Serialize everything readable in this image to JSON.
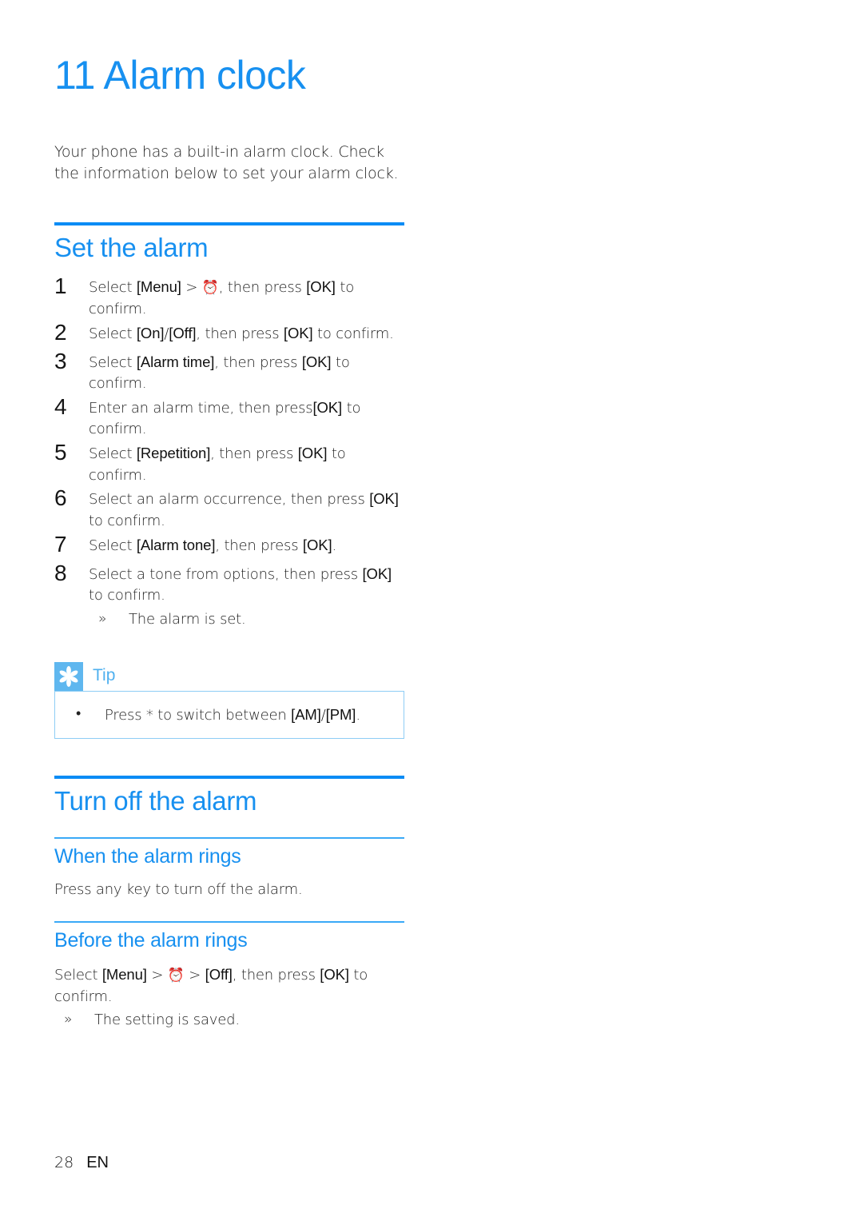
{
  "chapter": {
    "number": "11",
    "title": "11 Alarm clock",
    "intro": "Your phone has a built-in alarm clock. Check the information below to set your alarm clock."
  },
  "colors": {
    "accent_blue": "#1790f0",
    "rule_thick": "#0a8cf5",
    "rule_thin": "#3aa9f7",
    "tip_badge": "#5fb7ef",
    "tip_border": "#8ecdf5",
    "tip_label": "#4fb0ef",
    "body_text": "#1f1f1f"
  },
  "sections": {
    "set_alarm": {
      "heading": "Set the alarm",
      "steps": [
        {
          "num": "1",
          "parts": [
            {
              "t": "text",
              "v": "Select "
            },
            {
              "t": "ui",
              "v": "[Menu]"
            },
            {
              "t": "text",
              "v": " > "
            },
            {
              "t": "icon",
              "v": "alarm-clock-icon"
            },
            {
              "t": "text",
              "v": ", then press "
            },
            {
              "t": "ui",
              "v": "[OK]"
            },
            {
              "t": "text",
              "v": " to confirm."
            }
          ]
        },
        {
          "num": "2",
          "parts": [
            {
              "t": "text",
              "v": "Select "
            },
            {
              "t": "ui",
              "v": "[On]"
            },
            {
              "t": "text",
              "v": "/"
            },
            {
              "t": "ui",
              "v": "[Off]"
            },
            {
              "t": "text",
              "v": ", then press "
            },
            {
              "t": "ui",
              "v": "[OK]"
            },
            {
              "t": "text",
              "v": " to confirm."
            }
          ]
        },
        {
          "num": "3",
          "parts": [
            {
              "t": "text",
              "v": "Select "
            },
            {
              "t": "ui",
              "v": "[Alarm time]"
            },
            {
              "t": "text",
              "v": ", then press "
            },
            {
              "t": "ui",
              "v": "[OK]"
            },
            {
              "t": "text",
              "v": " to confirm."
            }
          ]
        },
        {
          "num": "4",
          "parts": [
            {
              "t": "text",
              "v": "Enter an alarm time, then press"
            },
            {
              "t": "ui",
              "v": "[OK]"
            },
            {
              "t": "text",
              "v": " to confirm."
            }
          ]
        },
        {
          "num": "5",
          "parts": [
            {
              "t": "text",
              "v": "Select "
            },
            {
              "t": "ui",
              "v": "[Repetition]"
            },
            {
              "t": "text",
              "v": ", then press "
            },
            {
              "t": "ui",
              "v": "[OK]"
            },
            {
              "t": "text",
              "v": " to confirm."
            }
          ]
        },
        {
          "num": "6",
          "parts": [
            {
              "t": "text",
              "v": "Select an alarm occurrence, then press "
            },
            {
              "t": "ui",
              "v": "[OK]"
            },
            {
              "t": "text",
              "v": " to confirm."
            }
          ]
        },
        {
          "num": "7",
          "parts": [
            {
              "t": "text",
              "v": "Select "
            },
            {
              "t": "ui",
              "v": "[Alarm tone]"
            },
            {
              "t": "text",
              "v": ", then press "
            },
            {
              "t": "ui",
              "v": "[OK]"
            },
            {
              "t": "text",
              "v": "."
            }
          ]
        },
        {
          "num": "8",
          "parts": [
            {
              "t": "text",
              "v": "Select a tone from options, then press "
            },
            {
              "t": "ui",
              "v": "[OK]"
            },
            {
              "t": "text",
              "v": " to confirm."
            }
          ],
          "result": {
            "marker": "»",
            "text": "The alarm is set."
          }
        }
      ],
      "tip": {
        "label": "Tip",
        "icon": "asterisk-icon",
        "items": [
          {
            "bullet": "•",
            "parts": [
              {
                "t": "text",
                "v": "Press * to switch between "
              },
              {
                "t": "ui",
                "v": "[AM]"
              },
              {
                "t": "text",
                "v": "/"
              },
              {
                "t": "ui",
                "v": "[PM]"
              },
              {
                "t": "text",
                "v": "."
              }
            ]
          }
        ]
      }
    },
    "turn_off_alarm": {
      "heading": "Turn off the alarm",
      "subsections": [
        {
          "heading": "When the alarm rings",
          "paragraph": "Press any key to turn off the alarm."
        },
        {
          "heading": "Before the alarm rings",
          "parts": [
            {
              "t": "text",
              "v": "Select "
            },
            {
              "t": "ui",
              "v": "[Menu]"
            },
            {
              "t": "text",
              "v": " > "
            },
            {
              "t": "icon",
              "v": "alarm-clock-icon"
            },
            {
              "t": "text",
              "v": " > "
            },
            {
              "t": "ui",
              "v": "[Off]"
            },
            {
              "t": "text",
              "v": ", then press "
            },
            {
              "t": "ui",
              "v": "[OK]"
            },
            {
              "t": "text",
              "v": " to confirm."
            }
          ],
          "result": {
            "marker": "»",
            "text": "The setting is saved."
          }
        }
      ]
    }
  },
  "footer": {
    "page_number": "28",
    "language": "EN"
  }
}
